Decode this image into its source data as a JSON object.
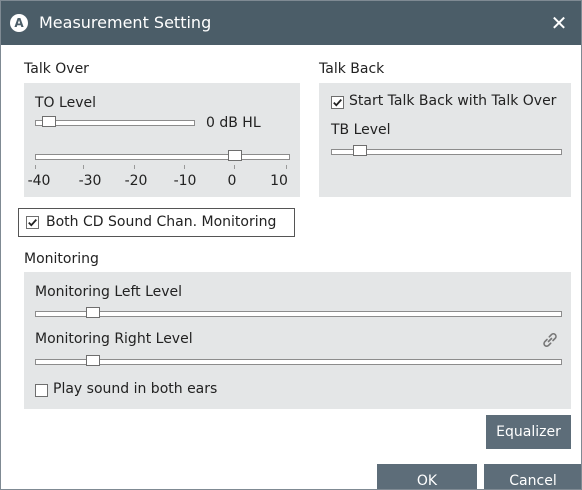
{
  "window": {
    "title": "Measurement Setting",
    "app_icon_letter": "A",
    "close_glyph": "✕"
  },
  "talk_over": {
    "header": "Talk Over",
    "to_level_label": "TO Level",
    "to_level_value": "0 dB HL",
    "scale_labels": [
      "-40",
      "-30",
      "-20",
      "-10",
      "0",
      "10"
    ],
    "scale_slider_value_db": 0,
    "to_level_slider_fraction": 0.05
  },
  "talk_back": {
    "header": "Talk Back",
    "start_with_to_label": "Start Talk Back with Talk Over",
    "start_with_to_checked": true,
    "tb_level_label": "TB Level",
    "tb_level_slider_fraction": 0.1
  },
  "both_cd": {
    "label": "Both CD Sound Chan. Monitoring",
    "checked": true
  },
  "monitoring": {
    "header": "Monitoring",
    "left_label": "Monitoring Left Level",
    "left_slider_fraction": 0.1,
    "right_label": "Monitoring Right Level",
    "right_slider_fraction": 0.1,
    "link_icon": "link-icon",
    "both_ears_label": "Play sound in both ears",
    "both_ears_checked": false
  },
  "buttons": {
    "equalizer": "Equalizer",
    "ok": "OK",
    "cancel": "Cancel"
  },
  "colors": {
    "titlebar": "#4b5d68",
    "panel": "#e4e6e7",
    "button": "#5d6d79",
    "link_icon": "#777777"
  }
}
